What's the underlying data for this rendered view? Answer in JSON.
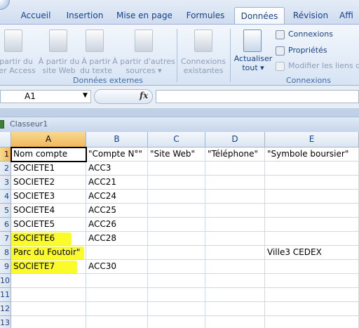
{
  "ribbon_tabs": [
    "Accueil",
    "Insertion",
    "Mise en page",
    "Formules",
    "Données",
    "Révision",
    "Affi"
  ],
  "active_tab": "Données",
  "external_data": {
    "buttons": [
      "partir du\nier Access",
      "À partir du\nsite Web",
      "À partir\ndu texte",
      "À partir d'autres\nsources ▾"
    ],
    "group_label": "Données externes"
  },
  "connections": {
    "existing_label": "Connexions\nexistantes",
    "refresh_label": "Actualiser\ntout ▾",
    "connexions": "Connexions",
    "proprietes": "Propriétés",
    "modifier_liens": "Modifier les liens d'",
    "group_label": "Connexions"
  },
  "formula_bar": {
    "name_box": "A1",
    "fx_label": "fx",
    "formula": ""
  },
  "workbook_title": "Classeur1",
  "columns": [
    "A",
    "B",
    "C",
    "D",
    "E"
  ],
  "rows": [
    {
      "n": "1",
      "cells": [
        "Nom compte",
        "\"Compte N°\"",
        "\"Site Web\"",
        "\"Téléphone\"",
        "\"Symbole boursier\""
      ]
    },
    {
      "n": "2",
      "cells": [
        "SOCIETE1",
        "ACC3",
        "",
        "",
        ""
      ]
    },
    {
      "n": "3",
      "cells": [
        "SOCIETE2",
        "ACC21",
        "",
        "",
        ""
      ]
    },
    {
      "n": "4",
      "cells": [
        "SOCIETE3",
        "ACC24",
        "",
        "",
        ""
      ]
    },
    {
      "n": "5",
      "cells": [
        "SOCIETE4",
        "ACC25",
        "",
        "",
        ""
      ]
    },
    {
      "n": "6",
      "cells": [
        "SOCIETE5",
        "ACC26",
        "",
        "",
        ""
      ]
    },
    {
      "n": "7",
      "cells": [
        "SOCIETE6",
        "ACC28",
        "",
        "",
        ""
      ]
    },
    {
      "n": "8",
      "cells": [
        "Parc du Foutoir\"",
        "",
        "",
        "",
        "Ville3 CEDEX"
      ]
    },
    {
      "n": "9",
      "cells": [
        "SOCIETE7",
        "ACC30",
        "",
        "",
        ""
      ]
    },
    {
      "n": "10",
      "cells": [
        "",
        "",
        "",
        "",
        ""
      ]
    },
    {
      "n": "11",
      "cells": [
        "",
        "",
        "",
        "",
        ""
      ]
    },
    {
      "n": "12",
      "cells": [
        "",
        "",
        "",
        "",
        ""
      ]
    },
    {
      "n": "13",
      "cells": [
        "",
        "",
        "",
        "",
        ""
      ]
    }
  ],
  "highlighted_cells": [
    "A7",
    "A8",
    "A9"
  ],
  "highlight_color": "#fbfb2a",
  "selected_cell": "A1"
}
